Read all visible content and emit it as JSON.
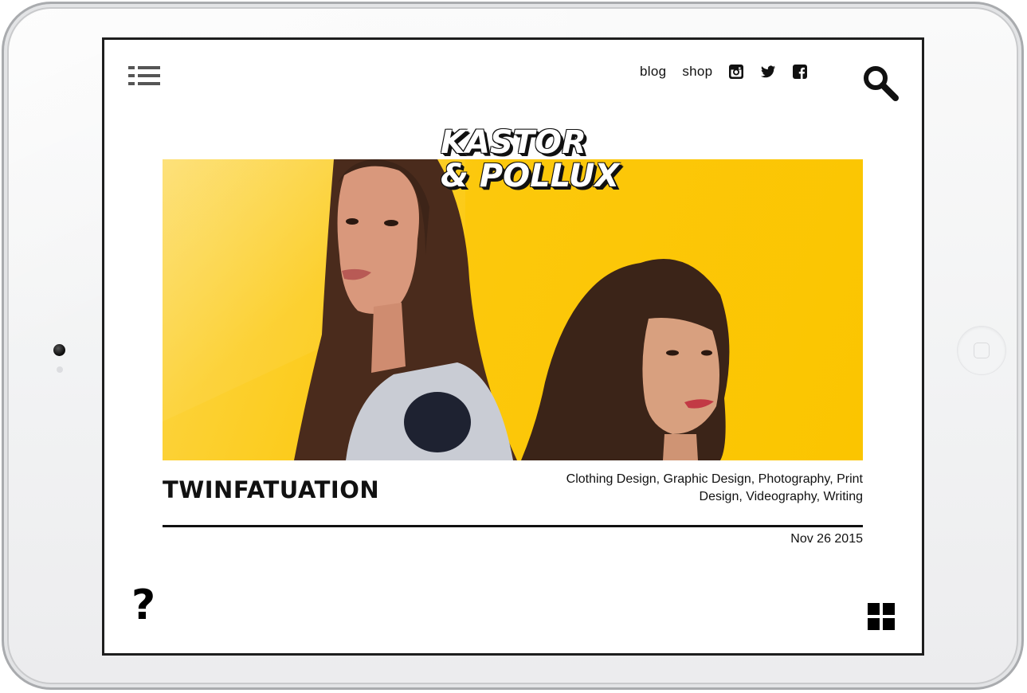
{
  "nav": {
    "links": [
      "blog",
      "shop"
    ],
    "social": [
      "instagram-icon",
      "twitter-icon",
      "facebook-icon"
    ]
  },
  "hero": {
    "logo_line1": "KASTOR",
    "logo_line2": "& POLLUX",
    "background_color": "#fcc80c"
  },
  "post": {
    "title": "TWINFATUATION",
    "tags": "Clothing Design, Graphic Design, Photography, Print Design, Videography, Writing",
    "date": "Nov 26 2015"
  },
  "icons": {
    "help": "?",
    "menu": "list-menu-icon",
    "search": "search-icon",
    "grid": "grid-view-icon"
  }
}
